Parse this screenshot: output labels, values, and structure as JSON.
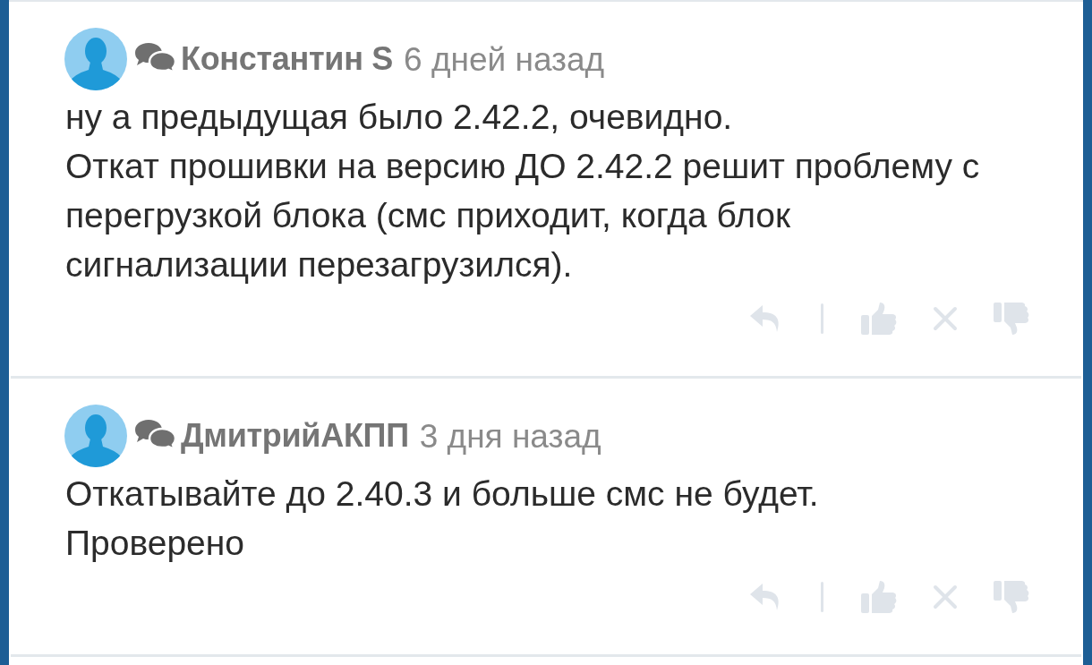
{
  "comments": [
    {
      "author": "Константин S",
      "time": "6 дней назад",
      "paragraphs": [
        "ну а предыдущая было 2.42.2, очевидно.",
        "Откат прошивки на версию ДО 2.42.2 решит проблему с перегрузкой блока (смс приходит, когда блок сигнализации перезагрузился)."
      ]
    },
    {
      "author": "ДмитрийАКПП",
      "time": "3 дня назад",
      "paragraphs": [
        "Откатывайте до 2.40.3 и больше смс не будет.",
        "Проверено"
      ]
    }
  ]
}
